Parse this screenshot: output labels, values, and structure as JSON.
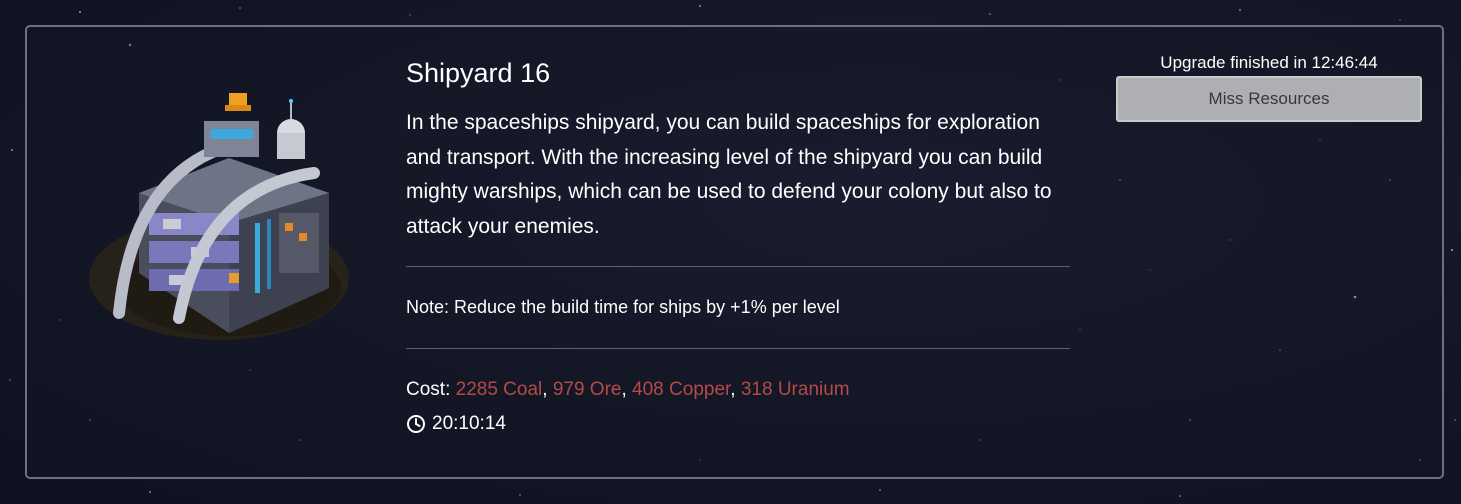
{
  "building": {
    "title": "Shipyard 16",
    "description": "In the spaceships shipyard, you can build spaceships for exploration and transport. With the increasing level of the shipyard you can build mighty warships, which can be used to defend your colony but also to attack your enemies.",
    "note": "Note: Reduce the build time for ships by +1% per level",
    "cost_label": "Cost:",
    "costs": [
      {
        "text": "2285 Coal"
      },
      {
        "text": "979 Ore"
      },
      {
        "text": "408 Copper"
      },
      {
        "text": "318 Uranium"
      }
    ],
    "cost_separator": ", ",
    "build_time": "20:10:14",
    "image_icon": "shipyard-building-image"
  },
  "upgrade": {
    "status": "Upgrade finished in 12:46:44",
    "button_label": "Miss Resources"
  },
  "colors": {
    "cost": "#b54a47",
    "button_bg": "#aeafb3",
    "panel_border": "#6d717d"
  }
}
